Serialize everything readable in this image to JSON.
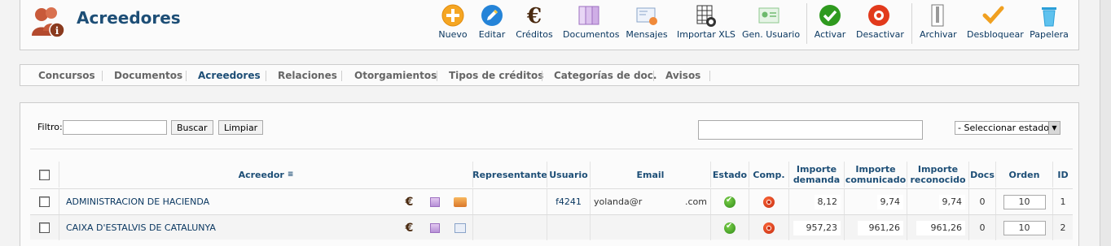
{
  "app": {
    "title": "Acreedores"
  },
  "toolbar": {
    "buttons": [
      {
        "id": "nuevo",
        "label": "Nuevo",
        "icon": "plus-circle-icon",
        "color": "#f39c12"
      },
      {
        "id": "editar",
        "label": "Editar",
        "icon": "pencil-icon",
        "color": "#1f7fd1"
      },
      {
        "id": "creditos",
        "label": "Créditos",
        "icon": "euro-icon",
        "color": "#4a2a10"
      },
      {
        "id": "documentos",
        "label": "Documentos",
        "icon": "documents-icon",
        "color": "#b68fd6"
      },
      {
        "id": "mensajes",
        "label": "Mensajes",
        "icon": "message-icon",
        "color": "#8aa4c9"
      },
      {
        "id": "importar_xls",
        "label": "Importar XLS",
        "icon": "spreadsheet-import-icon",
        "color": "#2b2b2b"
      },
      {
        "id": "gen_usuario",
        "label": "Gen. Usuario",
        "icon": "user-card-icon",
        "color": "#8fc98f"
      },
      {
        "id": "activar",
        "label": "Activar",
        "icon": "check-circle-icon",
        "color": "#2f8a18"
      },
      {
        "id": "desactivar",
        "label": "Desactivar",
        "icon": "stop-circle-icon",
        "color": "#e03b1b"
      },
      {
        "id": "archivar",
        "label": "Archivar",
        "icon": "archive-icon",
        "color": "#777777"
      },
      {
        "id": "desbloquear",
        "label": "Desbloquear",
        "icon": "unlock-check-icon",
        "color": "#f0a020"
      },
      {
        "id": "papelera",
        "label": "Papelera",
        "icon": "trash-icon",
        "color": "#2a9fd8"
      }
    ]
  },
  "submenu": {
    "items": [
      {
        "label": "Concursos",
        "active": false
      },
      {
        "label": "Documentos",
        "active": false
      },
      {
        "label": "Acreedores",
        "active": true
      },
      {
        "label": "Relaciones",
        "active": false
      },
      {
        "label": "Otorgamientos",
        "active": false
      },
      {
        "label": "Tipos de créditos",
        "active": false
      },
      {
        "label": "Categorías de doc.",
        "active": false
      },
      {
        "label": "Avisos",
        "active": false
      }
    ]
  },
  "filter": {
    "label": "Filtro:",
    "value": "",
    "search_button": "Buscar",
    "clear_button": "Limpiar",
    "secondary_value": "",
    "state_select": "- Seleccionar estado -"
  },
  "table": {
    "headers": {
      "acreedor": "Acreedor",
      "representante": "Representante",
      "usuario": "Usuario",
      "email": "Email",
      "estado": "Estado",
      "comp": "Comp.",
      "importe_demanda": "Importe demanda",
      "importe_comunicado": "Importe comunicado",
      "importe_reconocido": "Importe reconocido",
      "docs": "Docs",
      "orden": "Orden",
      "id": "ID"
    },
    "rows": [
      {
        "acreedor": "ADMINISTRACION DE HACIENDA",
        "representante": "",
        "usuario": "f4241",
        "email_user": "yolanda@r",
        "email_domain": ".com",
        "importe_demanda": "8,12",
        "importe_comunicado": "9,74",
        "importe_reconocido": "9,74",
        "docs": "0",
        "orden": "10",
        "id": "1"
      },
      {
        "acreedor": "CAIXA D'ESTALVIS DE CATALUNYA",
        "representante": "",
        "usuario": "",
        "email_user": "",
        "email_domain": "",
        "importe_demanda": "957,23",
        "importe_comunicado": "961,26",
        "importe_reconocido": "961,26",
        "docs": "0",
        "orden": "10",
        "id": "2"
      }
    ]
  }
}
